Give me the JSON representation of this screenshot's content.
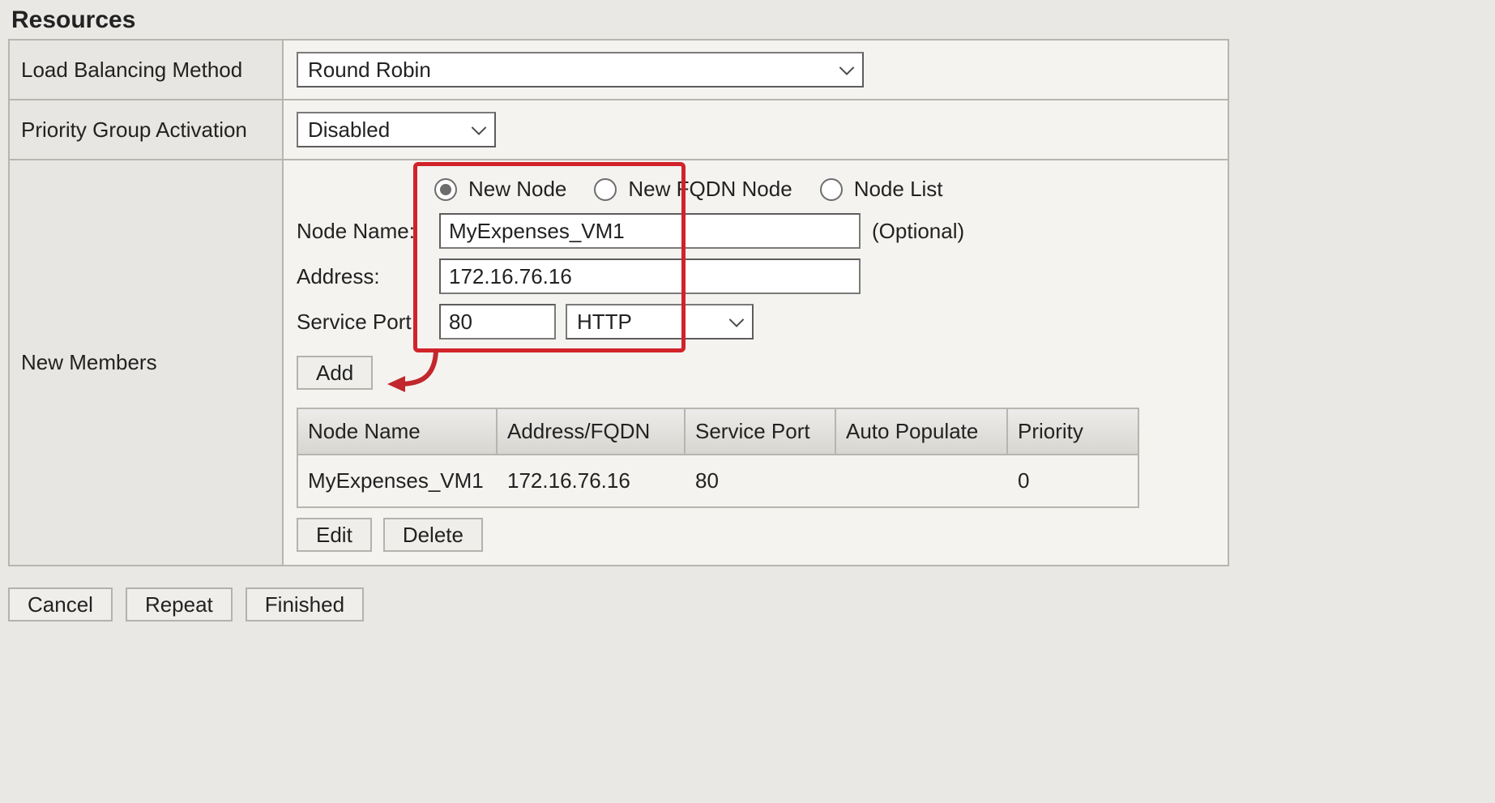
{
  "section_title": "Resources",
  "rows": {
    "lb_method": {
      "label": "Load Balancing Method",
      "value": "Round Robin"
    },
    "pga": {
      "label": "Priority Group Activation",
      "value": "Disabled"
    },
    "members_label": "New Members"
  },
  "node_type": {
    "options": [
      {
        "label": "New Node",
        "checked": true
      },
      {
        "label": "New FQDN Node",
        "checked": false
      },
      {
        "label": "Node List",
        "checked": false
      }
    ]
  },
  "form": {
    "node_name_label": "Node Name:",
    "node_name_value": "MyExpenses_VM1",
    "node_name_optional": "(Optional)",
    "address_label": "Address:",
    "address_value": "172.16.76.16",
    "port_label": "Service Port:",
    "port_value": "80",
    "port_proto": "HTTP",
    "add_btn": "Add"
  },
  "table": {
    "headers": [
      "Node Name",
      "Address/FQDN",
      "Service Port",
      "Auto Populate",
      "Priority"
    ],
    "rows": [
      {
        "name": "MyExpenses_VM1",
        "addr": "172.16.76.16",
        "port": "80",
        "auto": "",
        "prio": "0"
      }
    ],
    "edit_btn": "Edit",
    "delete_btn": "Delete"
  },
  "footer": {
    "cancel": "Cancel",
    "repeat": "Repeat",
    "finished": "Finished"
  }
}
